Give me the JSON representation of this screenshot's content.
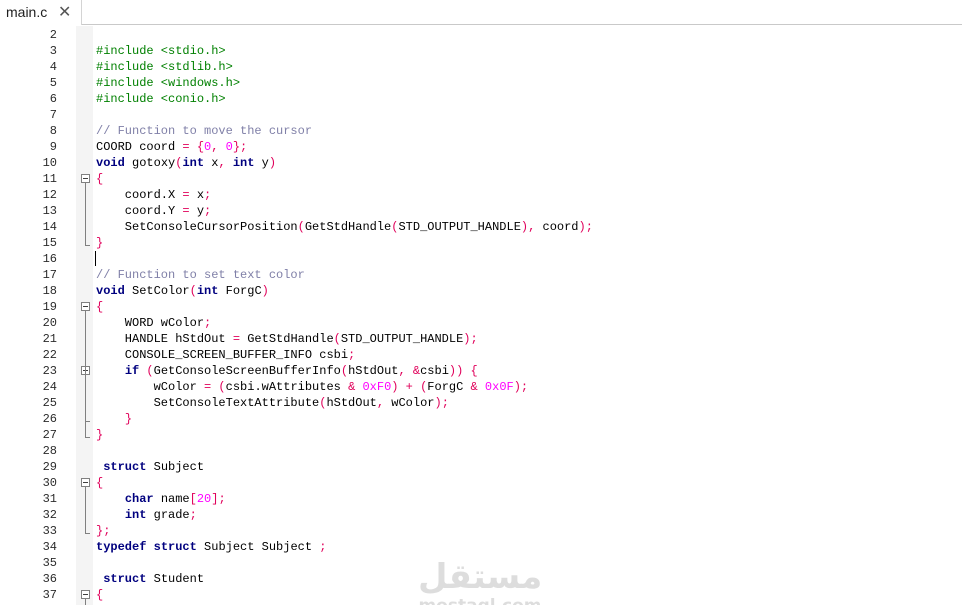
{
  "tab": {
    "title": "main.c",
    "close_glyph": "✕"
  },
  "lines": [
    {
      "n": "2",
      "tokens": []
    },
    {
      "n": "3",
      "tokens": [
        [
          "prep",
          "#include <stdio.h>"
        ]
      ]
    },
    {
      "n": "4",
      "tokens": [
        [
          "prep",
          "#include <stdlib.h>"
        ]
      ]
    },
    {
      "n": "5",
      "tokens": [
        [
          "prep",
          "#include <windows.h>"
        ]
      ]
    },
    {
      "n": "6",
      "tokens": [
        [
          "prep",
          "#include <conio.h>"
        ]
      ]
    },
    {
      "n": "7",
      "tokens": []
    },
    {
      "n": "8",
      "tokens": [
        [
          "comment",
          "// Function to move the cursor"
        ]
      ]
    },
    {
      "n": "9",
      "tokens": [
        [
          "plain",
          "COORD coord "
        ],
        [
          "op",
          "= {"
        ],
        [
          "num",
          "0"
        ],
        [
          "op",
          ", "
        ],
        [
          "num",
          "0"
        ],
        [
          "op",
          "};"
        ]
      ]
    },
    {
      "n": "10",
      "tokens": [
        [
          "kw",
          "void"
        ],
        [
          "plain",
          " gotoxy"
        ],
        [
          "op",
          "("
        ],
        [
          "kw",
          "int"
        ],
        [
          "plain",
          " x"
        ],
        [
          "op",
          ", "
        ],
        [
          "kw",
          "int"
        ],
        [
          "plain",
          " y"
        ],
        [
          "op",
          ")"
        ]
      ]
    },
    {
      "n": "11",
      "fold": "open",
      "tokens": [
        [
          "op",
          "{"
        ]
      ]
    },
    {
      "n": "12",
      "tokens": [
        [
          "plain",
          "    coord.X "
        ],
        [
          "op",
          "="
        ],
        [
          "plain",
          " x"
        ],
        [
          "op",
          ";"
        ]
      ]
    },
    {
      "n": "13",
      "tokens": [
        [
          "plain",
          "    coord.Y "
        ],
        [
          "op",
          "="
        ],
        [
          "plain",
          " y"
        ],
        [
          "op",
          ";"
        ]
      ]
    },
    {
      "n": "14",
      "tokens": [
        [
          "plain",
          "    SetConsoleCursorPosition"
        ],
        [
          "op",
          "("
        ],
        [
          "plain",
          "GetStdHandle"
        ],
        [
          "op",
          "("
        ],
        [
          "plain",
          "STD_OUTPUT_HANDLE"
        ],
        [
          "op",
          "),"
        ],
        [
          "plain",
          " coord"
        ],
        [
          "op",
          ");"
        ]
      ]
    },
    {
      "n": "15",
      "fold": "end",
      "tokens": [
        [
          "op",
          "}"
        ]
      ]
    },
    {
      "n": "16",
      "caret": true,
      "tokens": []
    },
    {
      "n": "17",
      "tokens": [
        [
          "comment",
          "// Function to set text color"
        ]
      ]
    },
    {
      "n": "18",
      "tokens": [
        [
          "kw",
          "void"
        ],
        [
          "plain",
          " SetColor"
        ],
        [
          "op",
          "("
        ],
        [
          "kw",
          "int"
        ],
        [
          "plain",
          " ForgC"
        ],
        [
          "op",
          ")"
        ]
      ]
    },
    {
      "n": "19",
      "fold": "open",
      "tokens": [
        [
          "op",
          "{"
        ]
      ]
    },
    {
      "n": "20",
      "tokens": [
        [
          "plain",
          "    WORD wColor"
        ],
        [
          "op",
          ";"
        ]
      ]
    },
    {
      "n": "21",
      "tokens": [
        [
          "plain",
          "    HANDLE hStdOut "
        ],
        [
          "op",
          "="
        ],
        [
          "plain",
          " GetStdHandle"
        ],
        [
          "op",
          "("
        ],
        [
          "plain",
          "STD_OUTPUT_HANDLE"
        ],
        [
          "op",
          ");"
        ]
      ]
    },
    {
      "n": "22",
      "tokens": [
        [
          "plain",
          "    CONSOLE_SCREEN_BUFFER_INFO csbi"
        ],
        [
          "op",
          ";"
        ]
      ]
    },
    {
      "n": "23",
      "fold": "open",
      "tokens": [
        [
          "plain",
          "    "
        ],
        [
          "kw",
          "if"
        ],
        [
          "plain",
          " "
        ],
        [
          "op",
          "("
        ],
        [
          "plain",
          "GetConsoleScreenBufferInfo"
        ],
        [
          "op",
          "("
        ],
        [
          "plain",
          "hStdOut"
        ],
        [
          "op",
          ", &"
        ],
        [
          "plain",
          "csbi"
        ],
        [
          "op",
          "))"
        ],
        [
          "plain",
          " "
        ],
        [
          "op",
          "{"
        ]
      ]
    },
    {
      "n": "24",
      "tokens": [
        [
          "plain",
          "        wColor "
        ],
        [
          "op",
          "= ("
        ],
        [
          "plain",
          "csbi.wAttributes "
        ],
        [
          "op",
          "&"
        ],
        [
          "plain",
          " "
        ],
        [
          "num",
          "0xF0"
        ],
        [
          "op",
          ") + ("
        ],
        [
          "plain",
          "ForgC "
        ],
        [
          "op",
          "&"
        ],
        [
          "plain",
          " "
        ],
        [
          "num",
          "0x0F"
        ],
        [
          "op",
          ");"
        ]
      ]
    },
    {
      "n": "25",
      "tokens": [
        [
          "plain",
          "        SetConsoleTextAttribute"
        ],
        [
          "op",
          "("
        ],
        [
          "plain",
          "hStdOut"
        ],
        [
          "op",
          ","
        ],
        [
          "plain",
          " wColor"
        ],
        [
          "op",
          ");"
        ]
      ]
    },
    {
      "n": "26",
      "fold": "end",
      "tokens": [
        [
          "plain",
          "    "
        ],
        [
          "op",
          "}"
        ]
      ]
    },
    {
      "n": "27",
      "fold": "end",
      "tokens": [
        [
          "op",
          "}"
        ]
      ]
    },
    {
      "n": "28",
      "tokens": []
    },
    {
      "n": "29",
      "tokens": [
        [
          "plain",
          " "
        ],
        [
          "kw",
          "struct"
        ],
        [
          "plain",
          " Subject"
        ]
      ]
    },
    {
      "n": "30",
      "fold": "open",
      "tokens": [
        [
          "op",
          "{"
        ]
      ]
    },
    {
      "n": "31",
      "tokens": [
        [
          "plain",
          "    "
        ],
        [
          "kw",
          "char"
        ],
        [
          "plain",
          " name"
        ],
        [
          "op",
          "["
        ],
        [
          "num",
          "20"
        ],
        [
          "op",
          "];"
        ]
      ]
    },
    {
      "n": "32",
      "tokens": [
        [
          "plain",
          "    "
        ],
        [
          "kw",
          "int"
        ],
        [
          "plain",
          " grade"
        ],
        [
          "op",
          ";"
        ]
      ]
    },
    {
      "n": "33",
      "fold": "end",
      "tokens": [
        [
          "op",
          "};"
        ]
      ]
    },
    {
      "n": "34",
      "tokens": [
        [
          "kw",
          "typedef"
        ],
        [
          "plain",
          " "
        ],
        [
          "kw",
          "struct"
        ],
        [
          "plain",
          " Subject Subject "
        ],
        [
          "op",
          ";"
        ]
      ]
    },
    {
      "n": "35",
      "tokens": []
    },
    {
      "n": "36",
      "tokens": [
        [
          "plain",
          " "
        ],
        [
          "kw",
          "struct"
        ],
        [
          "plain",
          " Student"
        ]
      ]
    },
    {
      "n": "37",
      "fold": "open",
      "tokens": [
        [
          "op",
          "{"
        ]
      ]
    }
  ],
  "watermark": {
    "arabic": "مستقل",
    "latin": "mostaql.com"
  },
  "colors": {
    "keyword": "#00007f",
    "preprocessor": "#008000",
    "comment": "#8080a8",
    "number": "#ff00ff",
    "operator": "#e0005a",
    "text": "#000000"
  }
}
